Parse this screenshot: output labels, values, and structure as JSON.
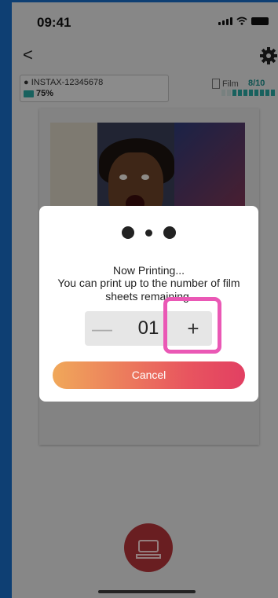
{
  "status_bar": {
    "time": "09:41"
  },
  "nav": {
    "back_label": "<"
  },
  "device": {
    "name": "INSTAX-12345678",
    "battery": "75%"
  },
  "film": {
    "label": "Film",
    "count": "8/10"
  },
  "dialog": {
    "title": "Now Printing...",
    "message": "You can print up to the number of film sheets remaining.",
    "stepper": {
      "minus_label": "—",
      "value": "01",
      "plus_label": "+"
    },
    "cancel_label": "Cancel"
  },
  "colors": {
    "accent_start": "#f0a85a",
    "accent_end": "#e23f62",
    "highlight": "#ea58b5",
    "print_button": "#b5343a",
    "film_bar": "#2aa7a3"
  }
}
